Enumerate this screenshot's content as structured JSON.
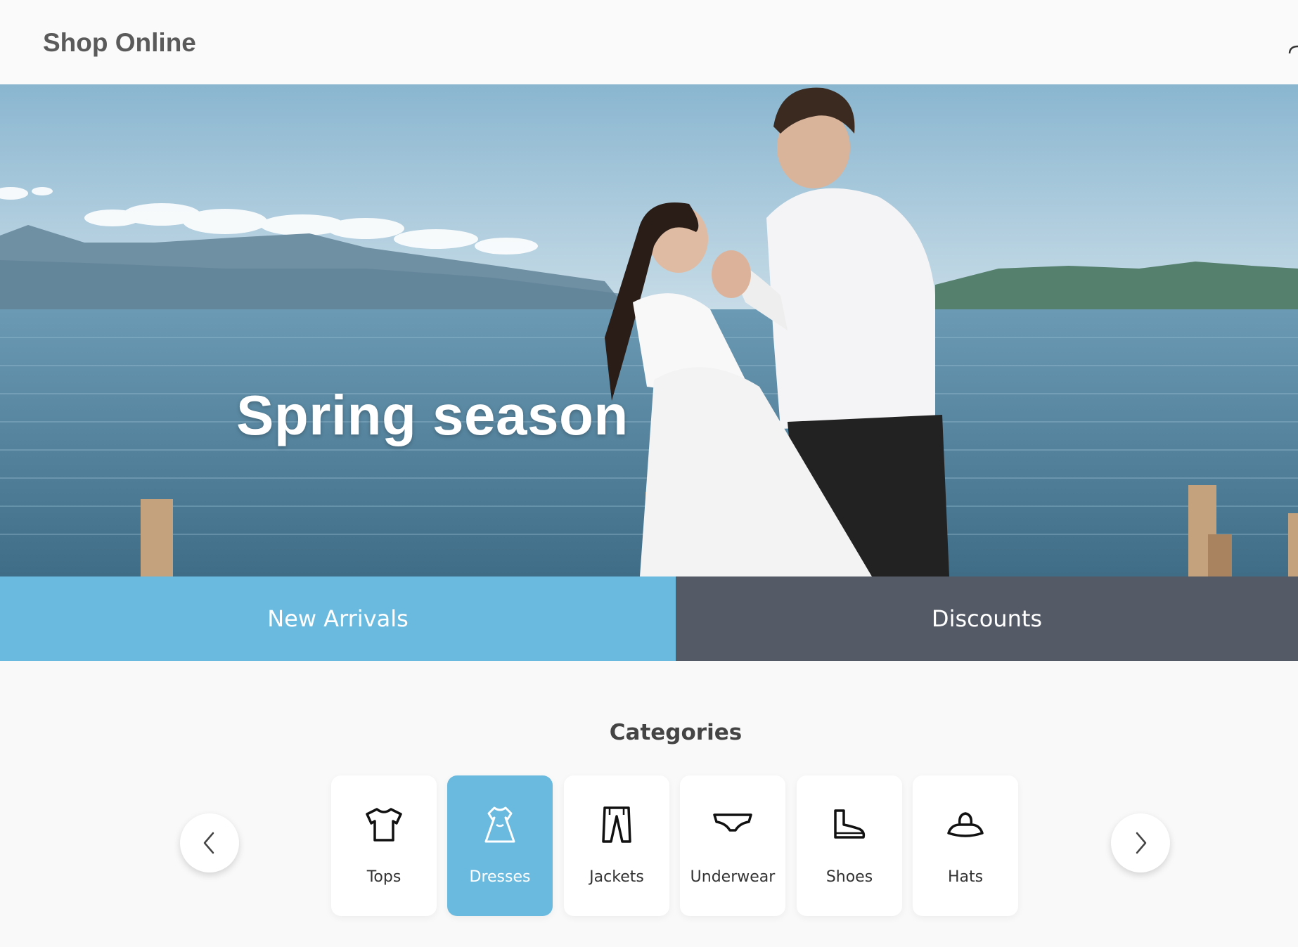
{
  "header": {
    "brand": "Shop Online",
    "cart_icon": "cart-icon"
  },
  "hero": {
    "title": "Spring season"
  },
  "promos": {
    "new_arrivals": "New Arrivals",
    "discounts": "Discounts"
  },
  "categories": {
    "title": "Categories",
    "prev_icon": "chevron-left-icon",
    "next_icon": "chevron-right-icon",
    "items": [
      {
        "label": "Tops",
        "icon": "t-shirt-icon",
        "active": false
      },
      {
        "label": "Dresses",
        "icon": "dress-icon",
        "active": true
      },
      {
        "label": "Jackets",
        "icon": "pants-icon",
        "active": false
      },
      {
        "label": "Underwear",
        "icon": "underwear-icon",
        "active": false
      },
      {
        "label": "Shoes",
        "icon": "boot-icon",
        "active": false
      },
      {
        "label": "Hats",
        "icon": "hat-icon",
        "active": false
      }
    ]
  },
  "colors": {
    "accent": "#6abae0",
    "dark": "#545a66",
    "text": "#444444"
  }
}
